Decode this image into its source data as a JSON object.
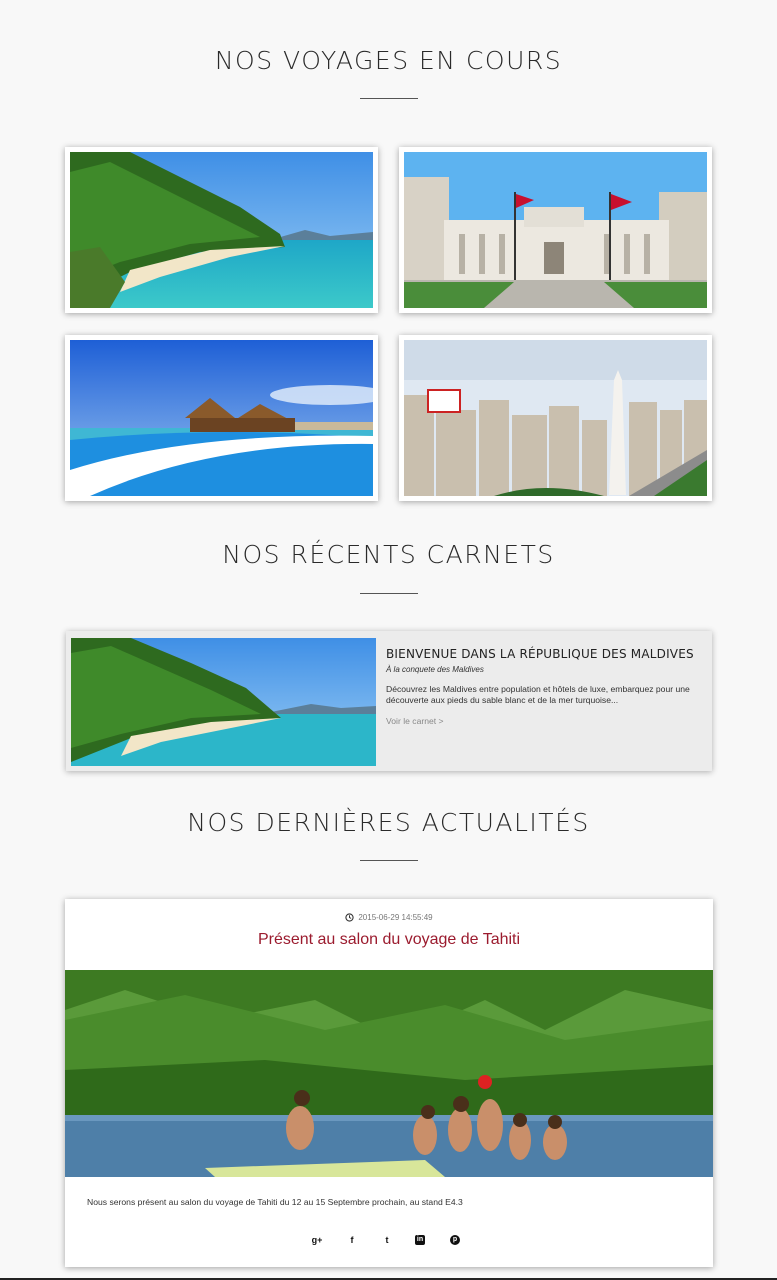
{
  "sections": {
    "voyages_title": "NOS VOYAGES EN COURS",
    "carnets_title": "NOS RÉCENTS CARNETS",
    "actualites_title": "NOS DERNIÈRES ACTUALITÉS"
  },
  "carnet": {
    "title": "BIENVENUE DANS LA RÉPUBLIQUE DES MALDIVES",
    "subtitle": "À la conquete des Maldives",
    "description": "Découvrez les Maldives entre population et hôtels de luxe, embarquez pour une découverte aux pieds du sable blanc et de la mer turquoise...",
    "link_label": "Voir le carnet >"
  },
  "news": {
    "date": "2015-06-29 14:55:49",
    "title": "Présent au salon du voyage de Tahiti",
    "body": "Nous serons présent au salon du voyage de Tahiti du 12 au 15 Septembre prochain, au stand E4.3"
  },
  "share": {
    "google": "g+",
    "facebook": "f",
    "twitter": "t",
    "linkedin": "in",
    "pinterest": "p"
  },
  "colors": {
    "background": "#f8f8f8",
    "news_title": "#9b1b2e",
    "carnet_bg": "#ececec"
  }
}
